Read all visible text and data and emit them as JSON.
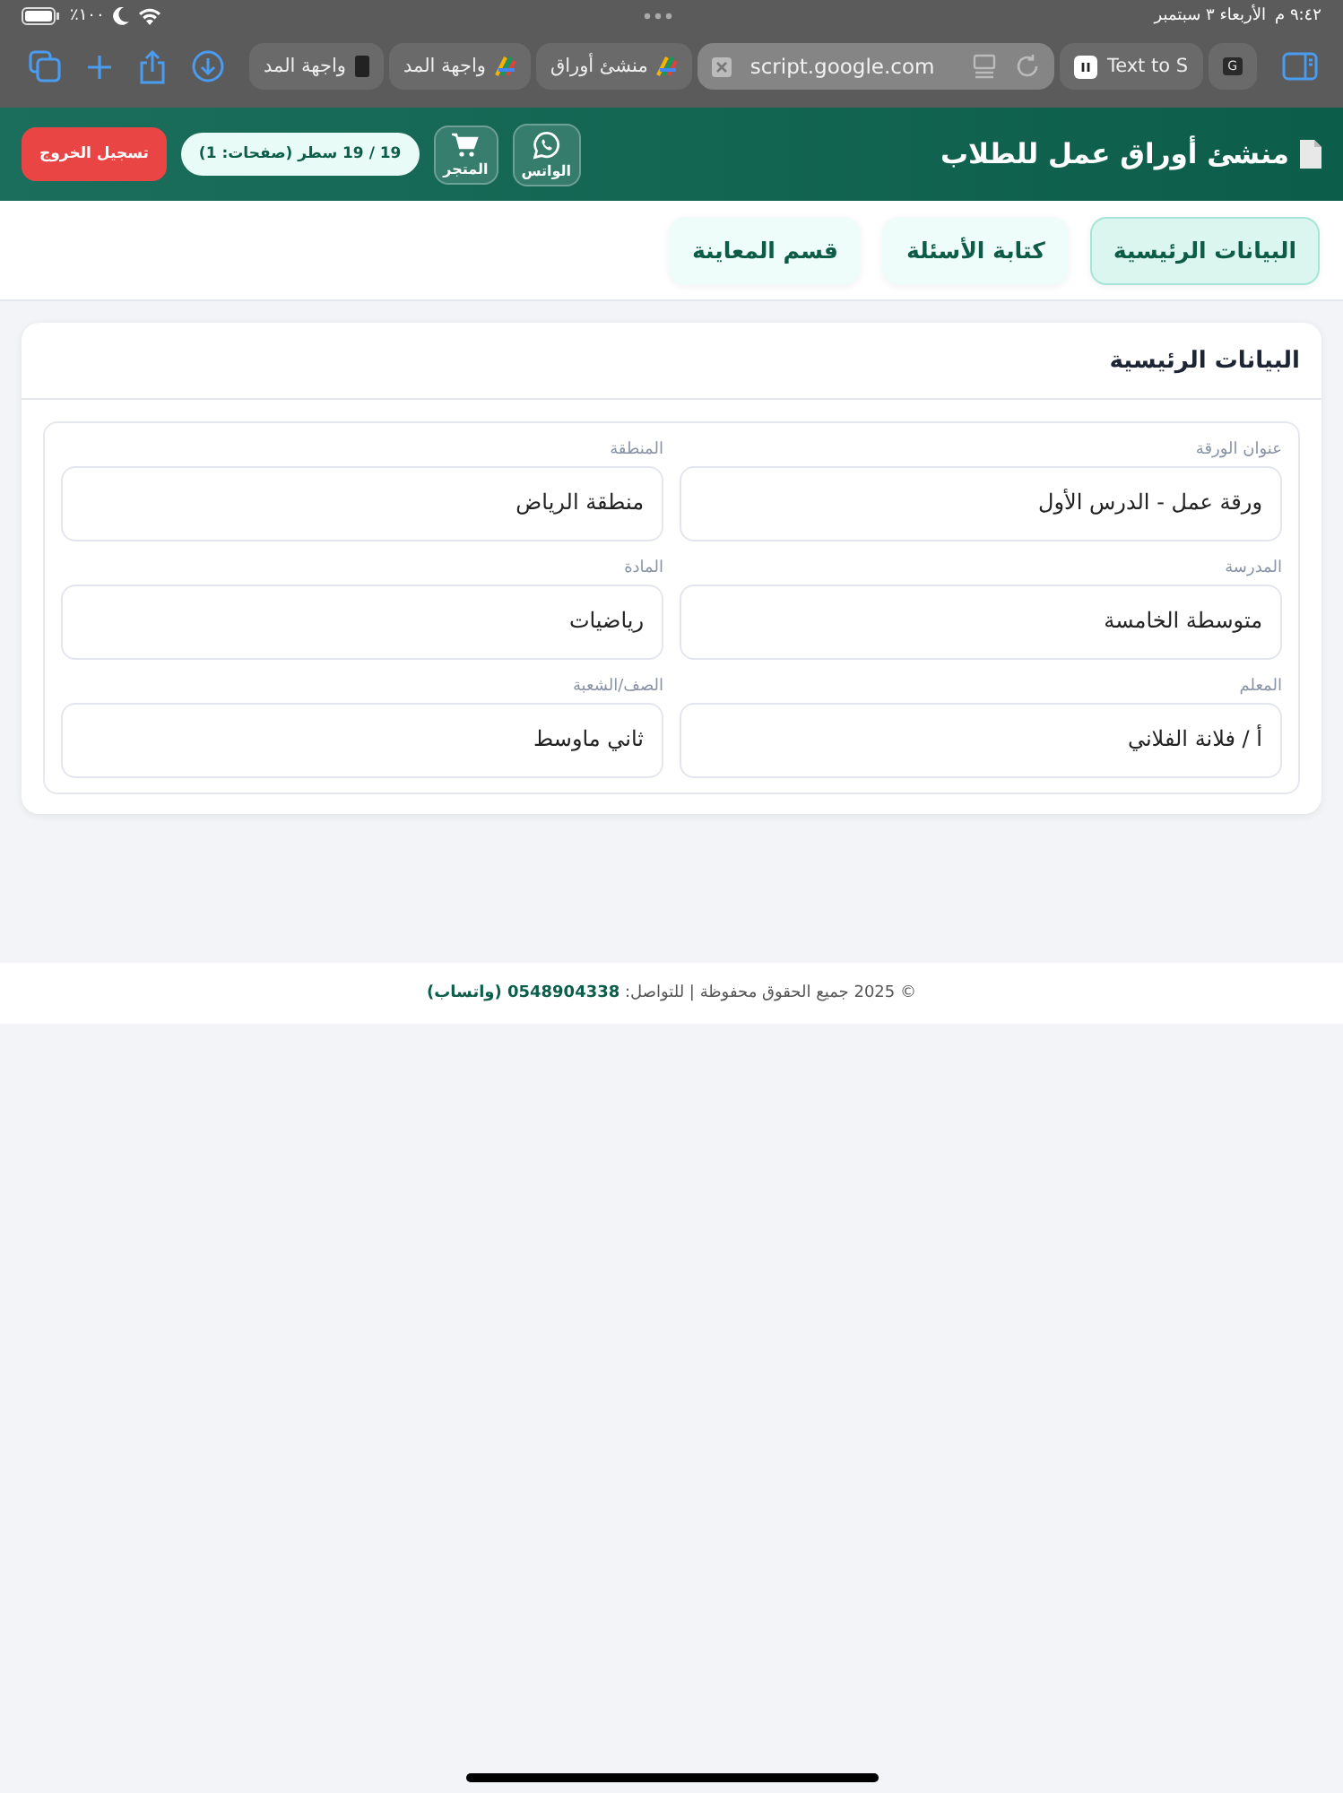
{
  "status_bar": {
    "time": "٩:٤٢ م",
    "date": "الأربعاء ٣ سبتمبر",
    "battery": "٪١٠٠"
  },
  "browser": {
    "tabs": [
      {
        "kind": "letter-tab",
        "label": "G"
      },
      {
        "kind": "media-tab",
        "label": "Text to S"
      },
      {
        "kind": "address",
        "label": "script.google.com"
      },
      {
        "kind": "pinwheel-tab",
        "label": "منشئ أوراق"
      },
      {
        "kind": "pinwheel-tab",
        "label": "واجهة المد"
      },
      {
        "kind": "dark-tab",
        "label": "واجهة المد"
      }
    ]
  },
  "header": {
    "title": "منشئ أوراق عمل للطلاب",
    "buttons": [
      {
        "kind": "whatsapp",
        "label": "الواتس"
      },
      {
        "kind": "store",
        "label": "المتجر"
      }
    ],
    "counter": "19 / 19 سطر (صفحات: 1)",
    "logout": "تسجيل الخروج"
  },
  "nav_tabs": [
    {
      "label": "البيانات الرئيسية",
      "selected": true
    },
    {
      "label": "كتابة الأسئلة",
      "selected": false
    },
    {
      "label": "قسم المعاينة",
      "selected": false
    }
  ],
  "card": {
    "title": "البيانات الرئيسية",
    "fields": [
      {
        "label": "عنوان الورقة",
        "value": "ورقة عمل - الدرس الأول"
      },
      {
        "label": "المنطقة",
        "value": "منطقة الرياض"
      },
      {
        "label": "المدرسة",
        "value": "متوسطة الخامسة"
      },
      {
        "label": "المادة",
        "value": "رياضيات"
      },
      {
        "label": "المعلم",
        "value": "أ / فلانة الفلاني"
      },
      {
        "label": "الصف/الشعبة",
        "value": "ثاني ماوسط"
      }
    ]
  },
  "footer": {
    "text": "© 2025 جميع الحقوق محفوظة | للتواصل: **0548904338 (واتساب)**"
  }
}
